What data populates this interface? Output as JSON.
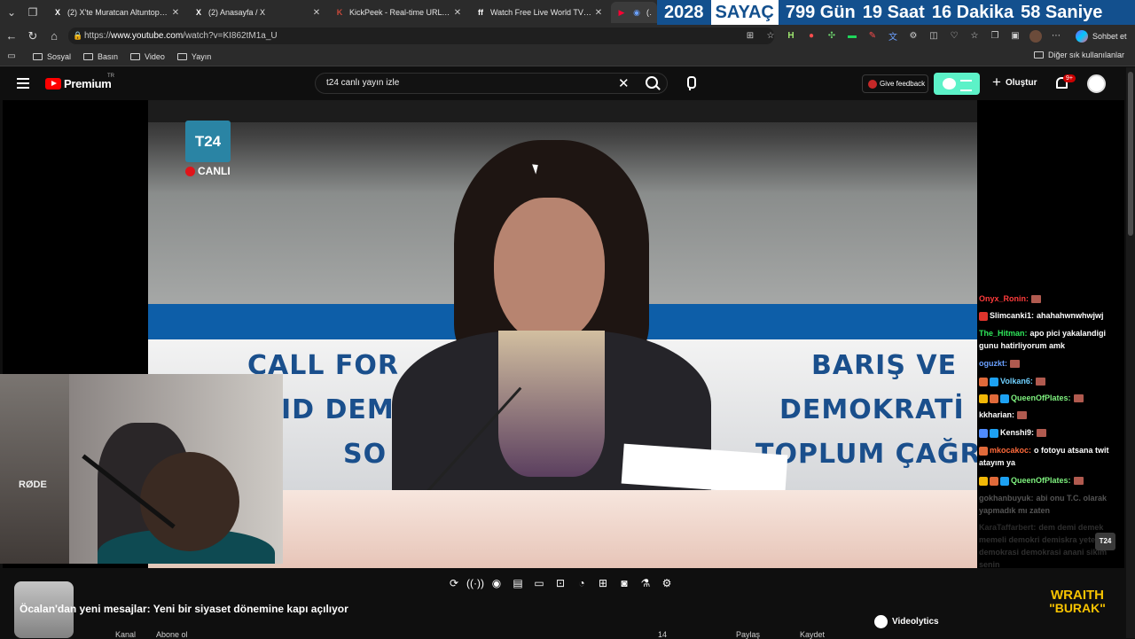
{
  "browser": {
    "tabs": [
      {
        "icon": "X",
        "title": "(2) X'te Muratcan Altuntoprak: \"A...",
        "active": false
      },
      {
        "icon": "X",
        "title": "(2) Anasayfa / X",
        "active": false
      },
      {
        "icon": "K",
        "title": "KickPeek - Real-time URL Crawler",
        "active": false
      },
      {
        "icon": "ff",
        "title": "Watch Free Live World TV | Global",
        "active": false
      },
      {
        "icon": "▶",
        "title": "(266",
        "active": true
      }
    ],
    "url_prefix": "https://",
    "url_host": "www.youtube.com",
    "url_path": "/watch?v=KI862tM1a_U",
    "chat_button": "Sohbet et",
    "bookmarks": [
      "Sosyal",
      "Basın",
      "Video",
      "Yayın"
    ],
    "other_bookmarks": "Diğer sık kullanılanlar"
  },
  "countdown": {
    "year": "2028",
    "label": "SAYAÇ",
    "days": "799 Gün",
    "hours": "19 Saat",
    "minutes": "16 Dakika",
    "seconds": "58 Saniye"
  },
  "youtube": {
    "logo": "Premium",
    "country": "TR",
    "search_query": "t24 canlı yayın izle",
    "feedback": "Give feedback",
    "create": "Oluştur",
    "notif_count": "9+",
    "video_title": "Öcalan'dan yeni mesajlar: Yeni bir siyaset dönemine kapı açılıyor",
    "videolytics": "Videolytics",
    "bottom_labels": [
      "Kanal",
      "Abone ol",
      "14",
      "Paylaş",
      "Kaydet"
    ]
  },
  "stream": {
    "channel_logo": "T24",
    "live_label": "CANLI",
    "banner_lines_left": [
      "CALL FOR",
      "ID DEM",
      "SO"
    ],
    "banner_lines_right": [
      "BARIŞ VE",
      "DEMOKRATİ",
      "TOPLUM ÇAĞR"
    ],
    "webcam_label": "RØDE",
    "chip": "T24",
    "overlay_line1": "WRAITH",
    "overlay_line2": "\"BURAK\""
  },
  "chat": [
    {
      "user": "Onyx_Ronin:",
      "text": "",
      "color": "#ff3b3b",
      "badges": []
    },
    {
      "user": "Slimcanki1:",
      "text": "ahahahwnwhwjwj",
      "color": "#ffffff",
      "badges": [
        "#e0342c"
      ]
    },
    {
      "user": "The_Hitman:",
      "text": "apo pici yakalandigi gunu hatirliyorum amk",
      "color": "#2ee65a",
      "badges": []
    },
    {
      "user": "oguzkt:",
      "text": "",
      "color": "#6aa0ff",
      "badges": []
    },
    {
      "user": "Volkan6:",
      "text": "",
      "color": "#6fd0ff",
      "badges": [
        "#e06a3a",
        "#1da1f2"
      ]
    },
    {
      "user": "QueenOfPlates:",
      "text": "",
      "color": "#7ff27f",
      "badges": [
        "#f2b807",
        "#e06a3a",
        "#1da1f2"
      ]
    },
    {
      "user": "kkharian:",
      "text": "",
      "color": "#ffffff",
      "badges": []
    },
    {
      "user": "Kenshi9:",
      "text": "",
      "color": "#ffffff",
      "badges": [
        "#4f8cff",
        "#1da1f2"
      ]
    },
    {
      "user": "mkocakoc:",
      "text": "o fotoyu atsana twit atayım ya",
      "color": "#ff6a3b",
      "badges": [
        "#e06a3a"
      ]
    },
    {
      "user": "QueenOfPlates:",
      "text": "",
      "color": "#7ff27f",
      "badges": [
        "#f2b807",
        "#e06a3a",
        "#1da1f2"
      ]
    },
    {
      "user": "gokhanbuyuk:",
      "text": "abi onu T.C. olarak yapmadık mı zaten",
      "color": "#9a9a9a",
      "badges": []
    },
    {
      "user": "KaraTaffarbert:",
      "text": "dem demi demek memeli demokri demiskra yeter lan demokrasi demokrasi anani sikim senin",
      "color": "#8a8a8a",
      "badges": []
    }
  ],
  "colors": {
    "counter_bg": "#13508e",
    "yt_red": "#ff0000",
    "accent_green": "#5cf2c8",
    "overlay_yellow": "#f7c300"
  }
}
